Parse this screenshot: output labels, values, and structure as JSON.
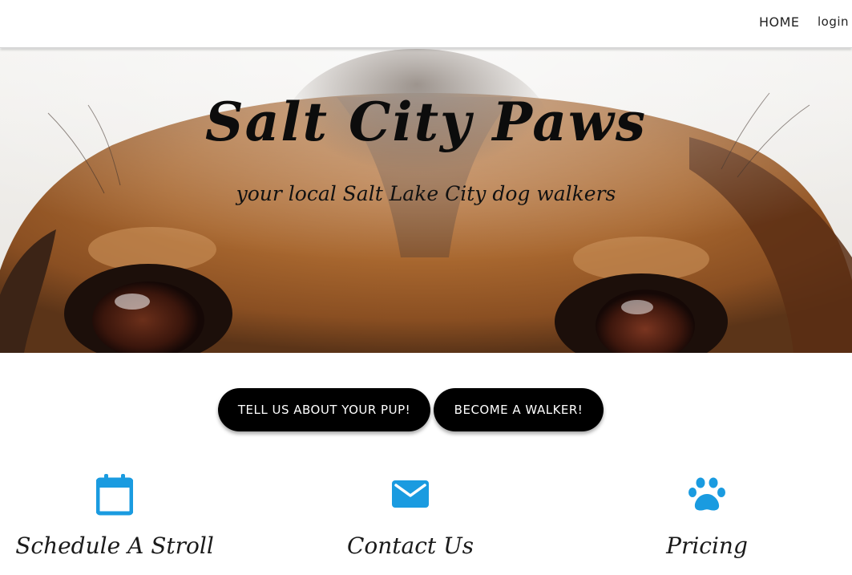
{
  "nav": {
    "home": "HOME",
    "login": "login"
  },
  "hero": {
    "title": "Salt City Paws",
    "subtitle": "your local Salt Lake City dog walkers"
  },
  "cta": {
    "pup": "TELL US ABOUT YOUR PUP!",
    "walker": "BECOME A WALKER!"
  },
  "features": [
    {
      "label": "Schedule A Stroll",
      "icon": "calendar-icon"
    },
    {
      "label": "Contact Us",
      "icon": "envelope-icon"
    },
    {
      "label": "Pricing",
      "icon": "paw-icon"
    }
  ],
  "colors": {
    "accent": "#1a9be0",
    "button": "#000000",
    "button_text": "#ffffff"
  }
}
